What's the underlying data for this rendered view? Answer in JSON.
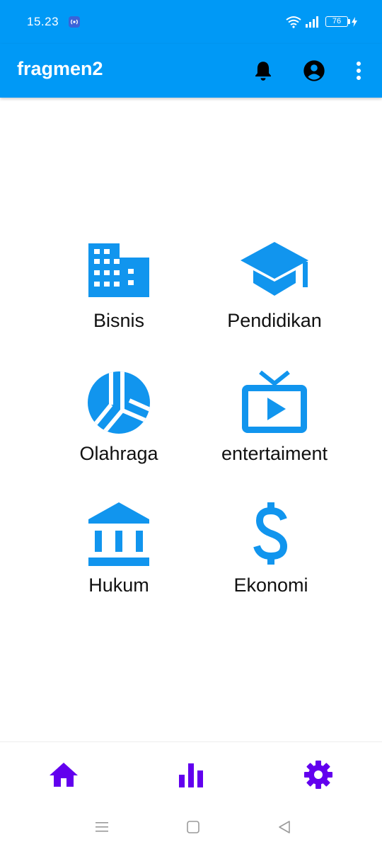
{
  "status_bar": {
    "time": "15.23",
    "battery": "76"
  },
  "app_bar": {
    "title": "fragmen2"
  },
  "categories": [
    {
      "label": "Bisnis",
      "icon": "building-icon"
    },
    {
      "label": "Pendidikan",
      "icon": "graduation-cap-icon"
    },
    {
      "label": "Olahraga",
      "icon": "volleyball-icon"
    },
    {
      "label": "entertaiment",
      "icon": "tv-play-icon"
    },
    {
      "label": "Hukum",
      "icon": "bank-icon"
    },
    {
      "label": "Ekonomi",
      "icon": "dollar-icon"
    }
  ],
  "bottom_nav": [
    "home-icon",
    "bar-chart-icon",
    "gear-icon"
  ],
  "colors": {
    "primary": "#0099f6",
    "icon_blue": "#1195ee",
    "nav_purple": "#6200ee"
  }
}
